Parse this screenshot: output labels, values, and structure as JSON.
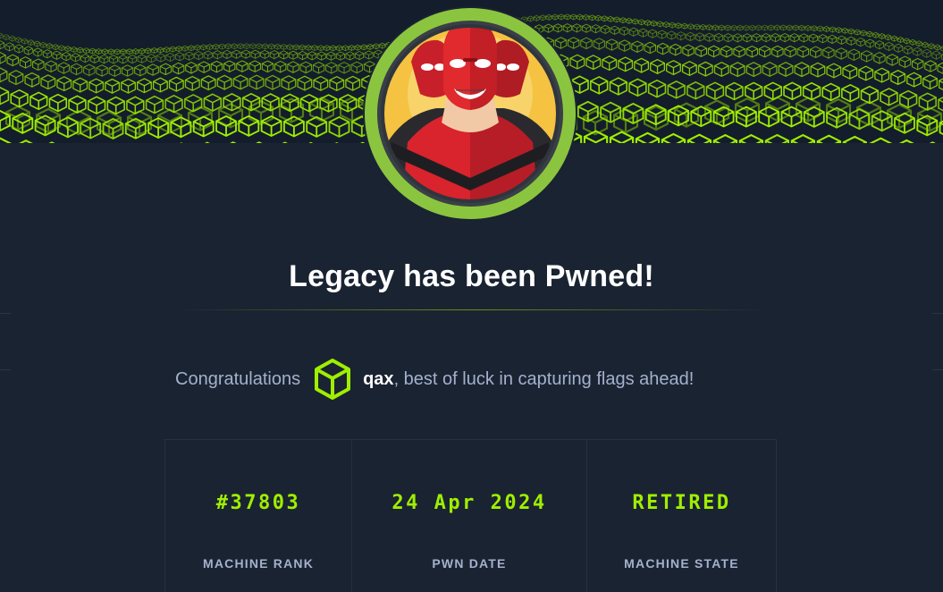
{
  "banner": {
    "accent_color": "#9fef00"
  },
  "machine": {
    "avatar": "red-masked-hero-avatar",
    "title": "Legacy has been Pwned!"
  },
  "congrats": {
    "prefix": "Congratulations",
    "user_icon": "green-cube-icon",
    "username": "qax",
    "suffix": ", best of luck in capturing flags ahead!"
  },
  "stats": [
    {
      "value": "#37803",
      "label": "MACHINE RANK"
    },
    {
      "value": "24 Apr 2024",
      "label": "PWN DATE"
    },
    {
      "value": "RETIRED",
      "label": "MACHINE STATE"
    }
  ],
  "colors": {
    "background": "#1a2332",
    "accent": "#9fef00",
    "muted_text": "#a4b1cd",
    "avatar_ring": "#8bc53f"
  }
}
